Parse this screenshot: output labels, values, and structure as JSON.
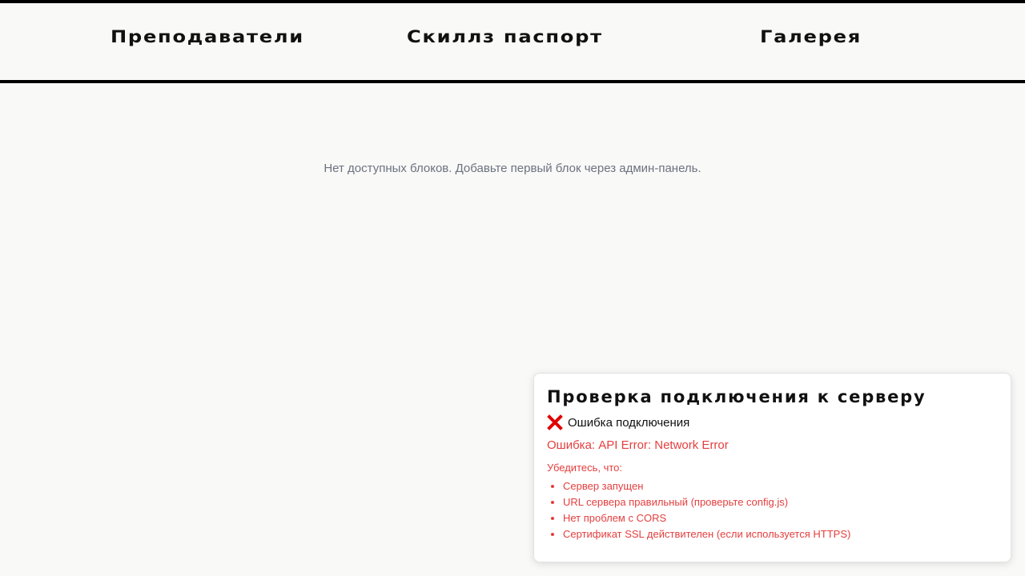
{
  "nav": {
    "items": [
      {
        "label": "Преподаватели"
      },
      {
        "label": "Скиллз паспорт"
      },
      {
        "label": "Галерея"
      }
    ]
  },
  "main": {
    "empty_message": "Нет доступных блоков. Добавьте первый блок через админ-панель."
  },
  "connection_panel": {
    "title": "Проверка подключения к серверу",
    "status_icon": "x-icon",
    "status_text": "Ошибка подключения",
    "error_text": "Ошибка: API Error: Network Error",
    "hint_label": "Убедитесь, что:",
    "hints": [
      "Сервер запущен",
      "URL сервера правильный (проверьте config.js)",
      "Нет проблем с CORS",
      "Сертификат SSL действителен (если используется HTTPS)"
    ],
    "colors": {
      "error": "#e53e3e",
      "icon": "#e00000"
    }
  }
}
